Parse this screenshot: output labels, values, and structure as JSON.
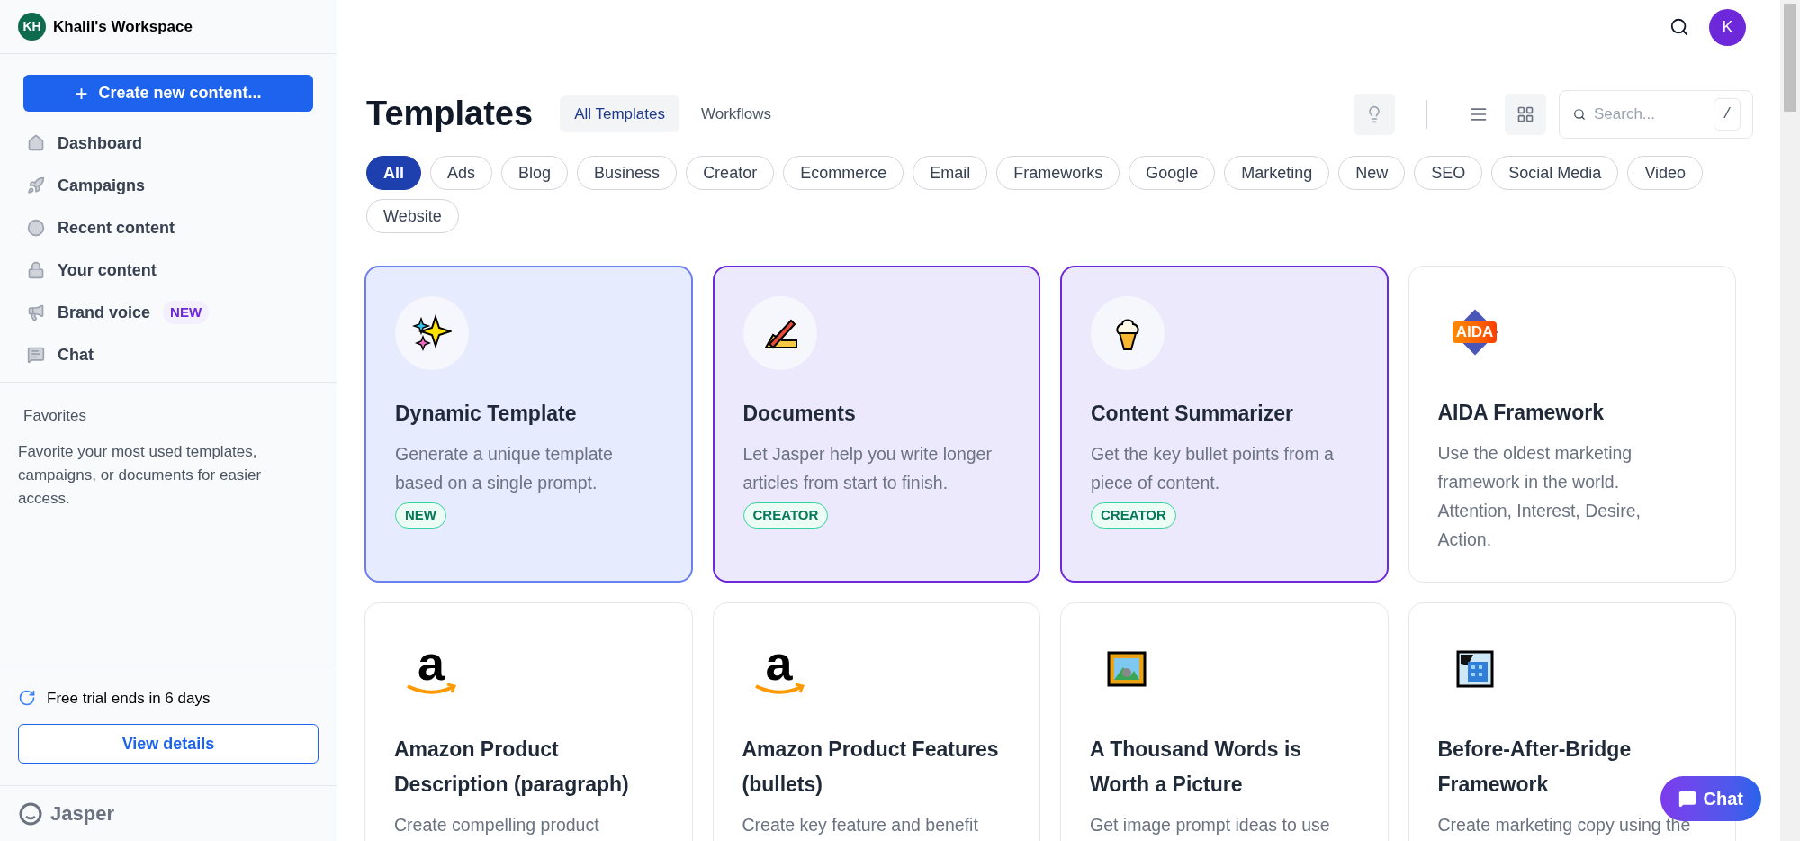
{
  "sidebar": {
    "workspace": {
      "initials": "KH",
      "name": "Khalil's Workspace"
    },
    "create_button": {
      "icon": "+",
      "label": "Create new content..."
    },
    "items": [
      {
        "label": "Dashboard"
      },
      {
        "label": "Campaigns"
      },
      {
        "label": "Recent content"
      },
      {
        "label": "Your content"
      },
      {
        "label": "Brand voice",
        "badge": "NEW"
      },
      {
        "label": "Chat"
      }
    ],
    "favorites": {
      "title": "Favorites",
      "text": "Favorite your most used templates, campaigns, or documents for easier access."
    },
    "trial": {
      "text": "Free trial ends in 6 days",
      "button": "View details"
    },
    "logo": "Jasper"
  },
  "topbar": {
    "avatar": "K"
  },
  "header": {
    "title": "Templates",
    "tabs": [
      {
        "label": "All Templates",
        "selected": true
      },
      {
        "label": "Workflows",
        "selected": false
      }
    ],
    "views": [
      {
        "kind": "list",
        "selected": false
      },
      {
        "kind": "grid",
        "selected": true
      }
    ],
    "search": {
      "placeholder": "Search...",
      "shortcut": "/"
    }
  },
  "filters": [
    {
      "label": "All",
      "selected": true
    },
    {
      "label": "Ads",
      "selected": false
    },
    {
      "label": "Blog",
      "selected": false
    },
    {
      "label": "Business",
      "selected": false
    },
    {
      "label": "Creator",
      "selected": false
    },
    {
      "label": "Ecommerce",
      "selected": false
    },
    {
      "label": "Email",
      "selected": false
    },
    {
      "label": "Frameworks",
      "selected": false
    },
    {
      "label": "Google",
      "selected": false
    },
    {
      "label": "Marketing",
      "selected": false
    },
    {
      "label": "New",
      "selected": false
    },
    {
      "label": "SEO",
      "selected": false
    },
    {
      "label": "Social Media",
      "selected": false
    },
    {
      "label": "Video",
      "selected": false
    },
    {
      "label": "Website",
      "selected": false
    }
  ],
  "cards": [
    {
      "title": "Dynamic Template",
      "description": "Generate a unique template based on a single prompt.",
      "badge": "NEW",
      "kind": "featured"
    },
    {
      "title": "Documents",
      "description": "Let Jasper help you write longer articles from start to finish.",
      "badge": "CREATOR",
      "kind": "highlighted"
    },
    {
      "title": "Content Summarizer",
      "description": "Get the key bullet points from a piece of content.",
      "badge": "CREATOR",
      "kind": "highlighted"
    },
    {
      "title": "AIDA Framework",
      "description": "Use the oldest marketing framework in the world. Attention, Interest, Desire, Action.",
      "logo_text": "AIDA",
      "kind": "plain"
    },
    {
      "title": "Amazon Product Description (paragraph)",
      "description": "Create compelling product",
      "logo_text": "a",
      "kind": "plain"
    },
    {
      "title": "Amazon Product Features (bullets)",
      "description": "Create key feature and benefit",
      "logo_text": "a",
      "kind": "plain"
    },
    {
      "title": "A Thousand Words is Worth a Picture",
      "description": "Get image prompt ideas to use",
      "kind": "plain"
    },
    {
      "title": "Before-After-Bridge Framework",
      "description": "Create marketing copy using the",
      "kind": "plain"
    }
  ],
  "chat_button": "Chat"
}
